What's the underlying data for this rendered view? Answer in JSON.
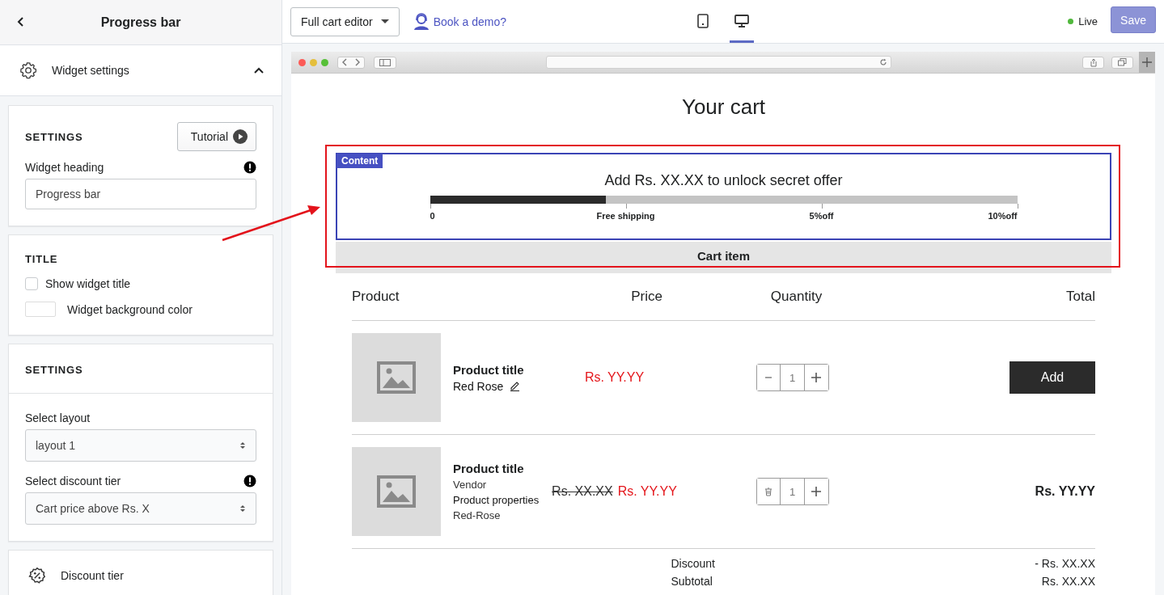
{
  "sidebar": {
    "title": "Progress bar",
    "section": {
      "label": "Widget settings",
      "expanded": true
    },
    "settings_card": {
      "heading": "SETTINGS",
      "tutorial_button": "Tutorial",
      "field_label": "Widget heading",
      "field_value": "Progress bar"
    },
    "title_card": {
      "heading": "TITLE",
      "show_title": {
        "label": "Show widget title",
        "checked": false
      },
      "background_color": {
        "label": "Widget background color",
        "color": "#ffffff"
      }
    },
    "layout_card": {
      "heading": "SETTINGS",
      "layout_label": "Select layout",
      "layout_value": "layout 1",
      "tier_label": "Select discount tier",
      "tier_value": "Cart price above Rs. X"
    },
    "discount_tier": {
      "label": "Discount tier"
    }
  },
  "toolbar": {
    "editor_dropdown": "Full cart editor",
    "demo_link": "Book a demo?",
    "devices": [
      {
        "kind": "mobile",
        "selected": false
      },
      {
        "kind": "desktop",
        "selected": true
      }
    ],
    "status": "Live",
    "save_button": "Save"
  },
  "preview": {
    "heading": "Your cart",
    "content_tag": "Content",
    "progress": {
      "message": "Add Rs. XX.XX to unlock secret offer",
      "level": 0.3,
      "milestones": [
        "0",
        "Free shipping",
        "5%off",
        "10%off"
      ]
    },
    "section_label": "Cart item",
    "columns": [
      "Product",
      "Price",
      "Quantity",
      "Total"
    ],
    "items": [
      {
        "title": "Product title",
        "details": [
          {
            "text": "Red Rose",
            "kind": "variant"
          }
        ],
        "price": "Rs. YY.YY",
        "quantity": {
          "kind": "minus",
          "value": "1"
        },
        "total": {
          "kind": "button",
          "text": "Add"
        }
      },
      {
        "title": "Product title",
        "details": [
          {
            "text": "Vendor",
            "kind": "meta"
          },
          {
            "text": "Product properties",
            "kind": "property"
          },
          {
            "text": "Red-Rose",
            "kind": "meta"
          }
        ],
        "old_price": "Rs. XX.XX",
        "price": "Rs. YY.YY",
        "quantity": {
          "kind": "delete",
          "value": "1"
        },
        "total": {
          "kind": "text",
          "text": "Rs. YY.YY"
        }
      }
    ],
    "summary": [
      {
        "label": "Discount",
        "value": "- Rs. XX.XX"
      },
      {
        "label": "Subtotal",
        "value": "Rs. XX.XX"
      }
    ]
  }
}
